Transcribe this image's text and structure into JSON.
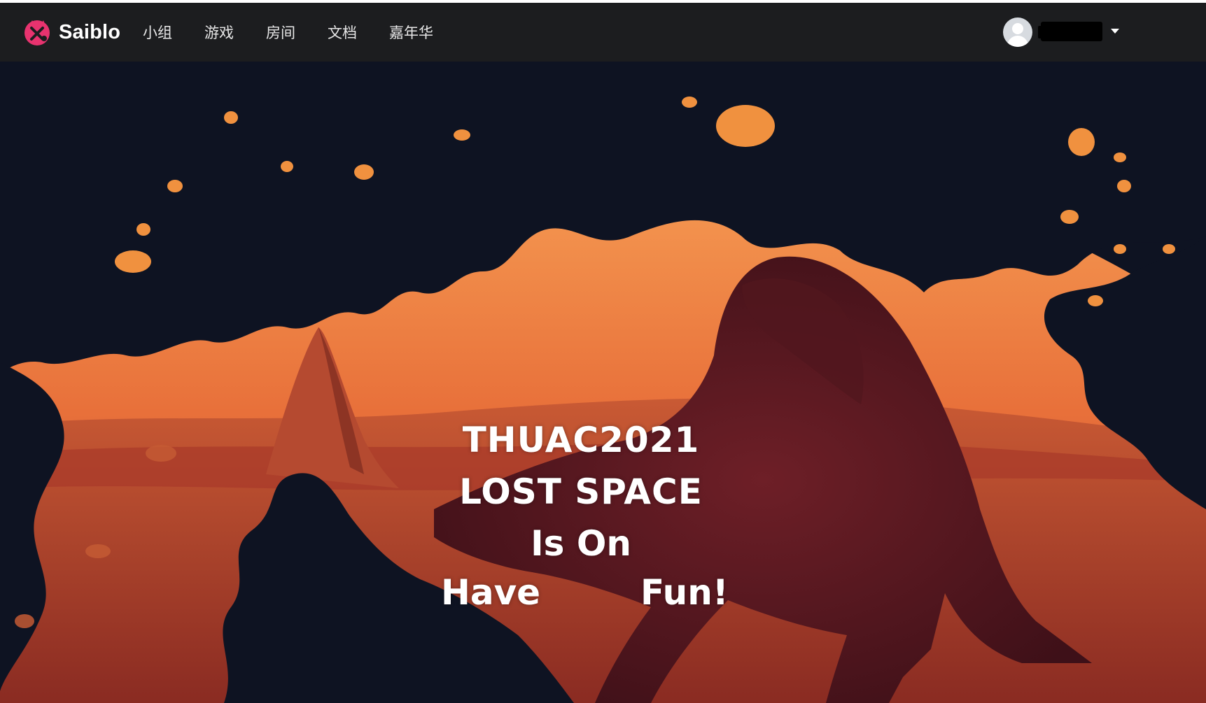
{
  "brand": {
    "name": "Saiblo",
    "logo_icon": "saiblo-logo-icon"
  },
  "nav": {
    "items": [
      {
        "label": "小组"
      },
      {
        "label": "游戏"
      },
      {
        "label": "房间"
      },
      {
        "label": "文档"
      },
      {
        "label": "嘉年华"
      }
    ]
  },
  "user": {
    "avatar_icon": "user-avatar-icon",
    "dropdown_icon": "caret-down-icon"
  },
  "hero": {
    "line1": "THUAC2021",
    "line2": "LOST SPACE",
    "line3": "Is On",
    "line4_left": "Have",
    "line4_right": "Fun!"
  },
  "colors": {
    "navbar_bg": "#1c1d1f",
    "hero_dark": "#0e1322",
    "hero_orange": "#e86a35",
    "logo_pink": "#e8336f"
  }
}
